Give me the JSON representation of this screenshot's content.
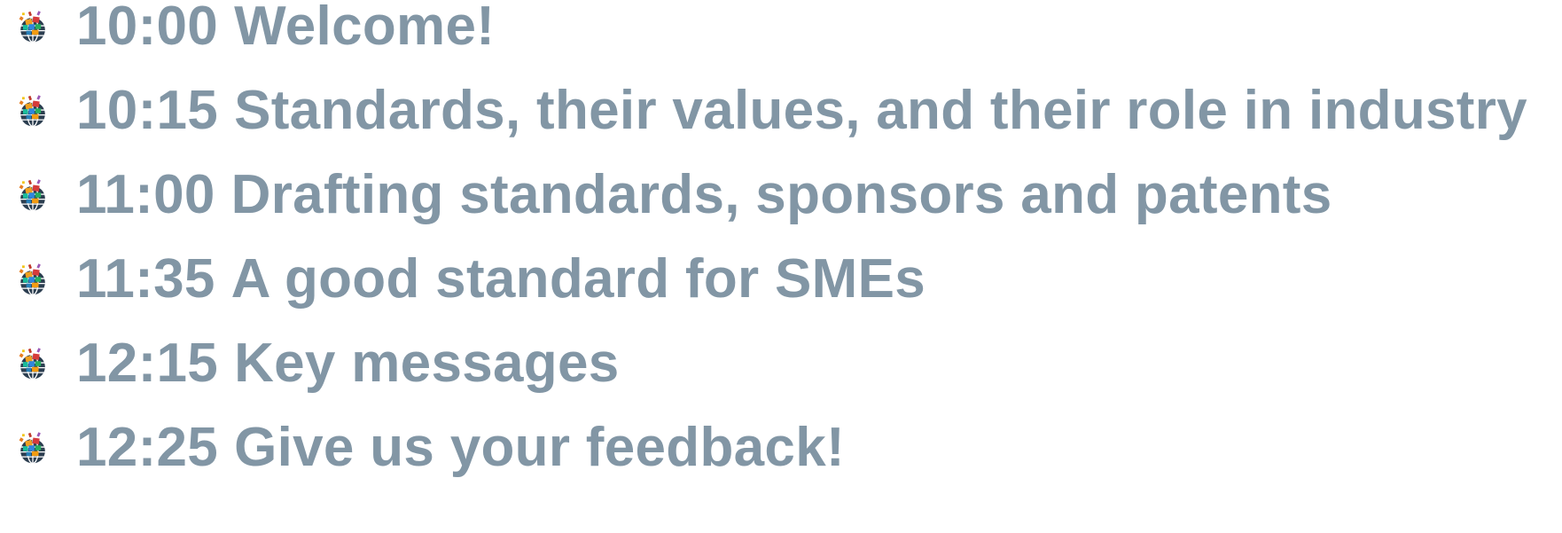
{
  "agenda": {
    "bullet_icon": "globe-with-colored-flags-icon",
    "text_color": "#8296a5",
    "items": [
      {
        "time": "10:00",
        "title": "Welcome!"
      },
      {
        "time": "10:15",
        "title": "Standards, their values, and their role in industry"
      },
      {
        "time": "11:00",
        "title": "Drafting standards, sponsors and patents"
      },
      {
        "time": "11:35",
        "title": "A good standard for SMEs"
      },
      {
        "time": "12:15",
        "title": "Key messages"
      },
      {
        "time": "12:25",
        "title": "Give us your feedback!"
      }
    ]
  }
}
